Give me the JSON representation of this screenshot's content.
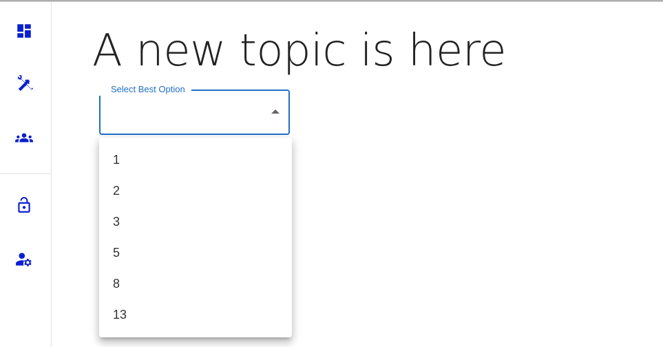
{
  "colors": {
    "nav_icon": "#0a1fd0",
    "accent": "#1f6fc7",
    "title_text": "#222222"
  },
  "sidebar": {
    "items": [
      {
        "icon": "dashboard-icon"
      },
      {
        "icon": "tools-icon"
      },
      {
        "icon": "groups-icon"
      },
      {
        "icon": "lock-open-icon"
      },
      {
        "icon": "user-settings-icon"
      }
    ]
  },
  "main": {
    "title": "A new topic is here"
  },
  "select": {
    "label": "Select Best Option",
    "value": "",
    "options": [
      "1",
      "2",
      "3",
      "5",
      "8",
      "13"
    ]
  }
}
